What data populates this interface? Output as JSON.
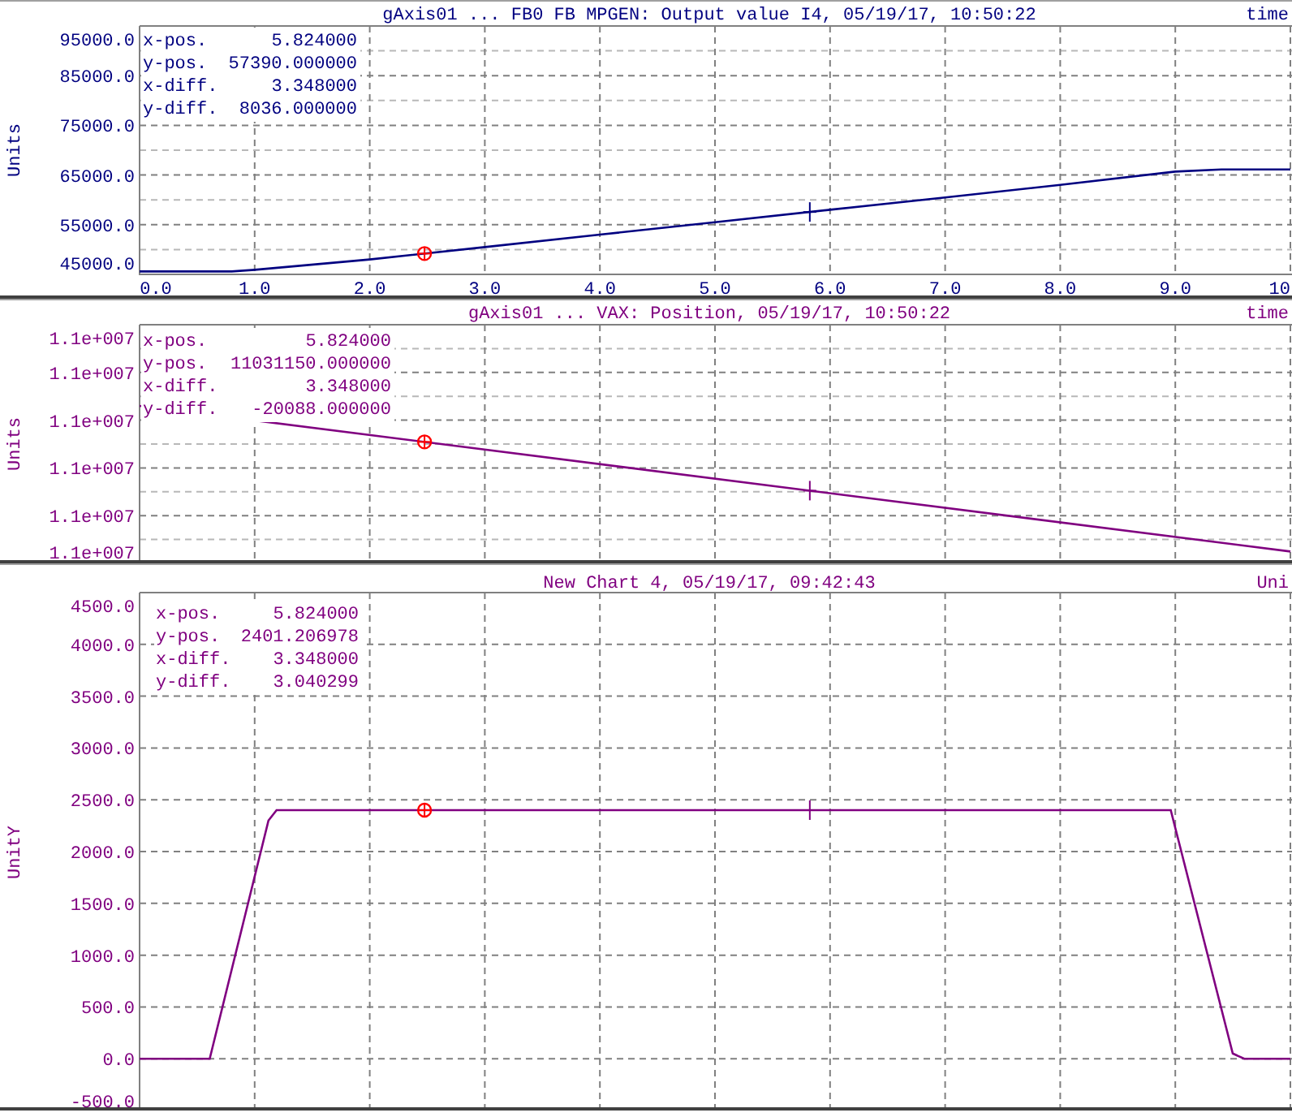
{
  "panels": [
    {
      "title": "gAxis01 ... FB0 FB MPGEN: Output value I4, 05/19/17, 10:50:22",
      "corner_label": "time",
      "minor_grid": true,
      "readout": [
        {
          "label": "x-pos.",
          "value": "5.824000"
        },
        {
          "label": "y-pos.",
          "value": "57390.000000"
        },
        {
          "label": "x-diff.",
          "value": "3.348000"
        },
        {
          "label": "y-diff.",
          "value": "8036.000000"
        }
      ],
      "chart_data": {
        "type": "line",
        "ylabel": "Units",
        "grid": true,
        "xlim": [
          0,
          10
        ],
        "ylim": [
          45000,
          95000
        ],
        "x": [
          0,
          0.8,
          1,
          2,
          3,
          4,
          5,
          6,
          7,
          8,
          9,
          9.4,
          10
        ],
        "series": [
          {
            "color": "#000080",
            "values": [
              45600,
              45600,
              45900,
              48000,
              50500,
              53000,
              55500,
              58000,
              60500,
              63000,
              65700,
              66100,
              66100
            ]
          }
        ],
        "xticks": [
          {
            "value": 0,
            "label": "0.0"
          },
          {
            "value": 1,
            "label": "1.0"
          },
          {
            "value": 2,
            "label": "2.0"
          },
          {
            "value": 3,
            "label": "3.0"
          },
          {
            "value": 4,
            "label": "4.0"
          },
          {
            "value": 5,
            "label": "5.0"
          },
          {
            "value": 6,
            "label": "6.0"
          },
          {
            "value": 7,
            "label": "7.0"
          },
          {
            "value": 8,
            "label": "8.0"
          },
          {
            "value": 9,
            "label": "9.0"
          },
          {
            "value": 10,
            "label": "10"
          }
        ],
        "yticks": [
          {
            "value": 95000,
            "label": "95000.0"
          },
          {
            "value": 85000,
            "label": "85000.0"
          },
          {
            "value": 75000,
            "label": "75000.0"
          },
          {
            "value": 65000,
            "label": "65000.0"
          },
          {
            "value": 55000,
            "label": "55000.0"
          },
          {
            "value": 45000,
            "label": "45000.0"
          }
        ]
      }
    },
    {
      "title": "gAxis01 ... VAX: Position, 05/19/17, 10:50:22",
      "corner_label": "time",
      "minor_grid": true,
      "readout": [
        {
          "label": "x-pos.",
          "value": "5.824000"
        },
        {
          "label": "y-pos.",
          "value": "11031150.000000"
        },
        {
          "label": "x-diff.",
          "value": "3.348000"
        },
        {
          "label": "y-diff.",
          "value": "-20088.000000"
        }
      ],
      "chart_data": {
        "type": "line",
        "ylabel": "Units",
        "grid": true,
        "xlim": [
          0,
          10
        ],
        "ylim": [
          11000000,
          11100000
        ],
        "x": [
          0,
          10
        ],
        "series": [
          {
            "color": "#800080",
            "values": [
              11066000,
              11005000
            ]
          }
        ],
        "yticks": [
          {
            "value": 11100000,
            "label": "1.1e+007"
          },
          {
            "value": 11080000,
            "label": "1.1e+007"
          },
          {
            "value": 11060000,
            "label": "1.1e+007"
          },
          {
            "value": 11040000,
            "label": "1.1e+007"
          },
          {
            "value": 11020000,
            "label": "1.1e+007"
          },
          {
            "value": 11000000,
            "label": "1.1e+007"
          }
        ]
      }
    },
    {
      "title": "New Chart 4, 05/19/17, 09:42:43",
      "corner_label": "Uni",
      "minor_grid": false,
      "readout": [
        {
          "label": "x-pos.",
          "value": "5.824000"
        },
        {
          "label": "y-pos.",
          "value": "2401.206978"
        },
        {
          "label": "x-diff.",
          "value": "3.348000"
        },
        {
          "label": "y-diff.",
          "value": "3.040299"
        }
      ],
      "chart_data": {
        "type": "line",
        "ylabel": "UnitY",
        "grid": true,
        "xlim": [
          0,
          10
        ],
        "ylim": [
          -515,
          4500
        ],
        "x": [
          0,
          0.61,
          1.12,
          1.19,
          8.96,
          9.5,
          9.6,
          10
        ],
        "series": [
          {
            "color": "#800080",
            "values": [
              0,
              0,
              2300,
              2400,
              2400,
              50,
              0,
              0
            ]
          }
        ],
        "yticks": [
          {
            "value": 4500,
            "label": "4500.0"
          },
          {
            "value": 4000,
            "label": "4000.0"
          },
          {
            "value": 3500,
            "label": "3500.0"
          },
          {
            "value": 3000,
            "label": "3000.0"
          },
          {
            "value": 2500,
            "label": "2500.0"
          },
          {
            "value": 2000,
            "label": "2000.0"
          },
          {
            "value": 1500,
            "label": "1500.0"
          },
          {
            "value": 1000,
            "label": "1000.0"
          },
          {
            "value": 500,
            "label": "500.0"
          },
          {
            "value": 0,
            "label": "0.0"
          },
          {
            "value": -500,
            "label": "-500.0"
          }
        ]
      }
    }
  ]
}
